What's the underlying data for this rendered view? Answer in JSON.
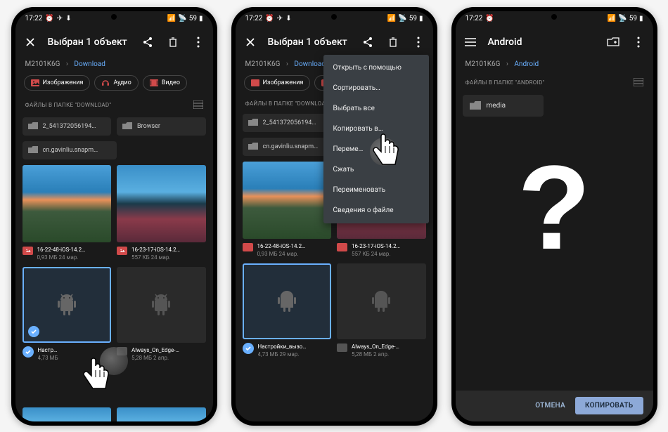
{
  "status": {
    "time": "17:22",
    "battery": "59"
  },
  "screen1": {
    "title": "Выбран 1 объект",
    "breadcrumb_root": "M2101K6G",
    "breadcrumb_current": "Download",
    "chips": {
      "images": "Изображения",
      "audio": "Аудио",
      "video": "Видео"
    },
    "section_label": "ФАЙЛЫ В ПАПКЕ \"DOWNLOAD\"",
    "folders": {
      "f1": "2_541372056194…",
      "f2": "Browser",
      "f3": "cn.gavinliu.snapm…"
    },
    "images": {
      "i1_name": "16-22-48-iOS-14.2…",
      "i1_sub": "0,93 МБ  24 мар.",
      "i2_name": "16-23-17-iOS-14.2…",
      "i2_sub": "557 КБ  24 мар."
    },
    "apps": {
      "a1_name": "Настр…",
      "a1_sub": "4,73 МБ",
      "a2_name": "Always_On_Edge-…",
      "a2_sub": "5,28 МБ  2 апр."
    }
  },
  "screen2": {
    "title": "Выбран 1 объект",
    "breadcrumb_root": "M2101K6G",
    "breadcrumb_current": "Download",
    "chips_images": "Изображения",
    "section_label": "ФАЙЛЫ В ПАПКЕ \"DOWNLOAD\"",
    "folders": {
      "f1": "2_541372056194…",
      "f3": "cn.gavinliu.snapm…"
    },
    "images": {
      "i1_name": "16-22-48-iOS-14.2…",
      "i1_sub": "0,93 МБ  24 мар.",
      "i2_name": "16-23-17-iOS-14.2…",
      "i2_sub": "557 КБ  24 мар."
    },
    "apps": {
      "a1_name": "Настройки_вызо…",
      "a1_sub": "4,73 МБ  29 мар.",
      "a2_name": "Always_On_Edge-…",
      "a2_sub": "5,28 МБ  2 апр."
    },
    "menu": {
      "open_with": "Открыть с помощью",
      "sort": "Сортировать…",
      "select_all": "Выбрать все",
      "copy_to": "Копировать в…",
      "move_to": "Переме…",
      "compress": "Сжать",
      "rename": "Переименовать",
      "details": "Сведения о файле"
    }
  },
  "screen3": {
    "title": "Android",
    "breadcrumb_root": "M2101K6G",
    "breadcrumb_current": "Android",
    "section_label": "ФАЙЛЫ В ПАПКЕ \"ANDROID\"",
    "folder_media": "media",
    "btn_cancel": "ОТМЕНА",
    "btn_copy": "КОПИРОВАТЬ",
    "question": "?"
  }
}
